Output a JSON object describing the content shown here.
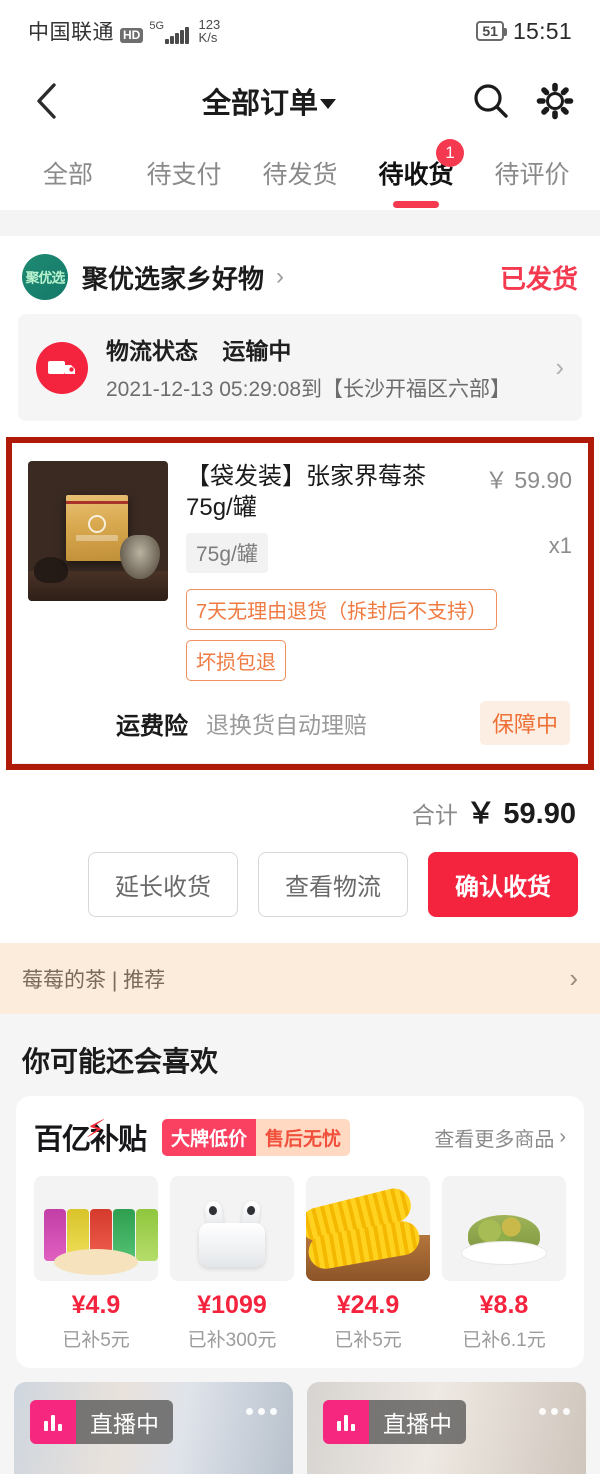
{
  "status_bar": {
    "carrier": "中国联通",
    "hd": "HD",
    "network": "5G",
    "speed_value": "123",
    "speed_unit": "K/s",
    "battery": "51",
    "time": "15:51"
  },
  "header": {
    "back_icon": "chevron-left-icon",
    "title": "全部订单",
    "search_icon": "search-icon",
    "settings_icon": "gear-icon"
  },
  "tabs": [
    {
      "label": "全部",
      "active": false,
      "badge": ""
    },
    {
      "label": "待支付",
      "active": false,
      "badge": ""
    },
    {
      "label": "待发货",
      "active": false,
      "badge": ""
    },
    {
      "label": "待收货",
      "active": true,
      "badge": "1"
    },
    {
      "label": "待评价",
      "active": false,
      "badge": ""
    }
  ],
  "order": {
    "shop_logo_text": "聚优选",
    "shop_name": "聚优选家乡好物",
    "shop_chevron": "›",
    "status": "已发货",
    "logistics": {
      "icon": "truck-icon",
      "label": "物流状态",
      "state": "运输中",
      "detail": "2021-12-13 05:29:08到【长沙开福区六部】",
      "chevron": "›"
    },
    "product": {
      "title": "【袋发装】张家界莓茶 75g/罐",
      "price": "￥ 59.90",
      "spec": "75g/罐",
      "quantity": "x1",
      "tags": [
        "7天无理由退货（拆封后不支持）",
        "坏损包退"
      ]
    },
    "insurance": {
      "label": "运费险",
      "desc": "退换货自动理赔",
      "badge": "保障中"
    },
    "total_label": "合计",
    "total_value": "￥ 59.90",
    "actions": [
      {
        "label": "延长收货",
        "style": "ghost"
      },
      {
        "label": "查看物流",
        "style": "ghost"
      },
      {
        "label": "确认收货",
        "style": "primary"
      }
    ]
  },
  "recommend_bar": {
    "text": "莓莓的茶 | 推荐",
    "chevron": "›"
  },
  "maybe_like_title": "你可能还会喜欢",
  "subsidy": {
    "logo": "百亿补贴",
    "tag1": "大牌低价",
    "tag2": "售后无忧",
    "more": "查看更多商品",
    "more_chevron": "›",
    "items": [
      {
        "price": "¥4.9",
        "subsidy": "已补5元",
        "art": "chips"
      },
      {
        "price": "¥1099",
        "subsidy": "已补300元",
        "art": "earbuds"
      },
      {
        "price": "¥24.9",
        "subsidy": "已补5元",
        "art": "corn"
      },
      {
        "price": "¥8.8",
        "subsidy": "已补6.1元",
        "art": "raisins"
      }
    ]
  },
  "live_cards": [
    {
      "badge": "直播中",
      "menu": "more-dots-icon"
    },
    {
      "badge": "直播中",
      "menu": "more-dots-icon"
    }
  ],
  "colors": {
    "brand_red": "#f5243e",
    "accent_red": "#f5394f",
    "tag_orange": "#ef7b42",
    "highlight_border": "#b01a08",
    "shop_green": "#1f8a72",
    "live_pink": "#f5277e"
  }
}
